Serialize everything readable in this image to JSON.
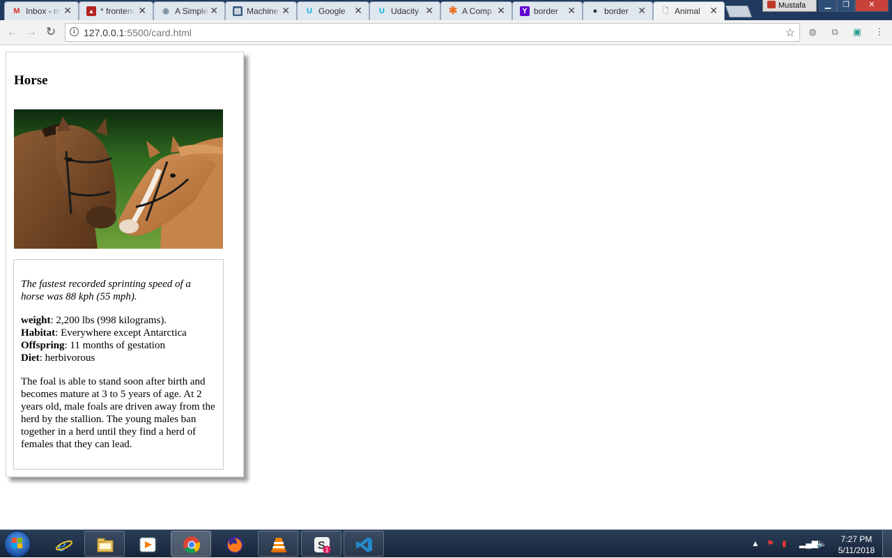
{
  "browser": {
    "tabs": [
      {
        "title": "Inbox - m",
        "icon": "gmail-icon",
        "color": "#d93025"
      },
      {
        "title": "* frontend",
        "icon": "generic-red-icon",
        "color": "#b22222"
      },
      {
        "title": "A Simple",
        "icon": "eye-icon",
        "color": "#7a8ca0"
      },
      {
        "title": "Machine",
        "icon": "document-icon",
        "color": "#3c5a80"
      },
      {
        "title": "Google",
        "icon": "udacity-icon",
        "color": "#02b3e4"
      },
      {
        "title": "Udacity",
        "icon": "udacity-icon",
        "color": "#02b3e4"
      },
      {
        "title": "A Comp",
        "icon": "asterisk-icon",
        "color": "#e8732a"
      },
      {
        "title": "border",
        "icon": "yahoo-icon",
        "color": "#5f01d1"
      },
      {
        "title": "border",
        "icon": "bird-icon",
        "color": "#1b2a3a"
      },
      {
        "title": "Animal",
        "icon": "page-icon",
        "color": "#666666",
        "active": true
      }
    ],
    "profile_name": "Mustafa",
    "url_host": "127.0.0.1",
    "url_path": ":5500/card.html"
  },
  "card": {
    "title": "Horse",
    "image_alt": "Two horses",
    "fact": "The fastest recorded sprinting speed of a horse was 88 kph (55 mph).",
    "stats": [
      {
        "label": "weight",
        "value": ": 2,200 lbs (998 kilograms)."
      },
      {
        "label": "Habitat",
        "value": ": Everywhere except Antarctica"
      },
      {
        "label": "Offspring",
        "value": ": 11 months of gestation"
      },
      {
        "label": "Diet",
        "value": ": herbivorous"
      }
    ],
    "description": "The foal is able to stand soon after birth and becomes mature at 3 to 5 years of age. At 2 years old, male foals are driven away from the herd by the stallion. The young males ban together in a herd until they find a herd of females that they can lead."
  },
  "taskbar": {
    "apps": [
      "internet-explorer-icon",
      "file-explorer-icon",
      "media-player-icon",
      "chrome-icon",
      "firefox-icon",
      "vlc-icon",
      "slack-icon",
      "vscode-icon"
    ],
    "slack_badge": "1",
    "time": "7:27 PM",
    "date": "5/11/2018"
  }
}
